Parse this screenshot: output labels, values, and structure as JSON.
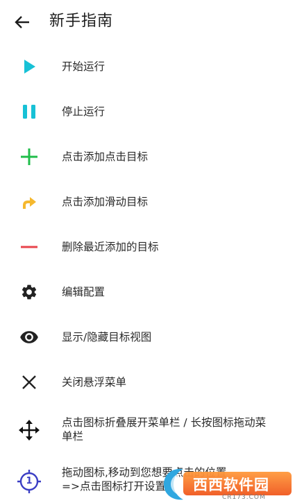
{
  "header": {
    "title": "新手指南",
    "back_icon": "arrow-back-icon"
  },
  "items": [
    {
      "label": "开始运行",
      "icon": "play-icon",
      "color": "#17c1d6"
    },
    {
      "label": "停止运行",
      "icon": "pause-icon",
      "color": "#17c1d6"
    },
    {
      "label": "点击添加点击目标",
      "icon": "plus-icon",
      "color": "#1fbd4a"
    },
    {
      "label": "点击添加滑动目标",
      "icon": "swipe-arrow-icon",
      "color": "#f5b82e"
    },
    {
      "label": "删除最近添加的目标",
      "icon": "minus-icon",
      "color": "#e8434b"
    },
    {
      "label": "编辑配置",
      "icon": "gear-icon",
      "color": "#222222"
    },
    {
      "label": "显示/隐藏目标视图",
      "icon": "eye-icon",
      "color": "#222222"
    },
    {
      "label": "关闭悬浮菜单",
      "icon": "close-icon",
      "color": "#222222"
    },
    {
      "label_line1": "点击图标折叠展开菜单栏 / 长按图标拖动菜",
      "label_line2": "单栏",
      "icon": "move-arrows-icon",
      "color": "#111111"
    },
    {
      "label_line1": "拖动图标,移动到您想要点击的位置",
      "label_line2": "=>点击图标打开设置",
      "icon": "target-crosshair-icon",
      "color": "#3b3ec4",
      "target_number": "1"
    }
  ],
  "watermark": {
    "brand": "西西软件园",
    "domain": "CR173.COM",
    "logo_icon": "watermark-logo-icon"
  }
}
